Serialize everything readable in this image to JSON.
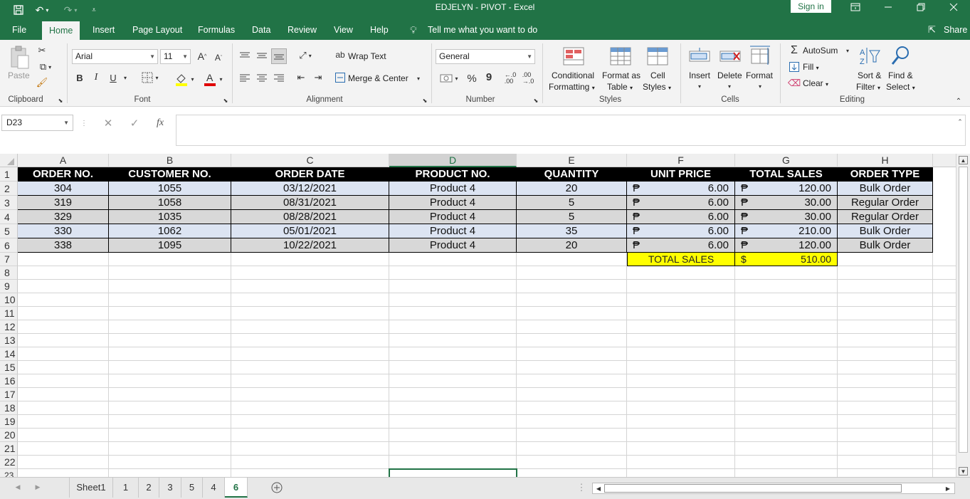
{
  "title_bar": {
    "title": "EDJELYN - PIVOT  -  Excel",
    "sign_in": "Sign in"
  },
  "menu": {
    "tabs": [
      "File",
      "Home",
      "Insert",
      "Page Layout",
      "Formulas",
      "Data",
      "Review",
      "View",
      "Help"
    ],
    "tell_me": "Tell me what you want to do",
    "share": "Share"
  },
  "ribbon": {
    "clipboard": {
      "paste": "Paste",
      "label": "Clipboard"
    },
    "font": {
      "name": "Arial",
      "size": "11",
      "bold": "B",
      "italic": "I",
      "underline": "U",
      "grow": "A",
      "shrink": "A",
      "label": "Font"
    },
    "alignment": {
      "wrap_text": "Wrap Text",
      "merge_center": "Merge & Center",
      "label": "Alignment"
    },
    "number": {
      "format": "General",
      "percent": "%",
      "comma": "9",
      "label": "Number"
    },
    "styles": {
      "conditional": [
        "Conditional",
        "Formatting"
      ],
      "format_table": [
        "Format as",
        "Table"
      ],
      "cell_styles": [
        "Cell",
        "Styles"
      ],
      "label": "Styles"
    },
    "cells": {
      "insert": "Insert",
      "delete": "Delete",
      "format": "Format",
      "label": "Cells"
    },
    "editing": {
      "autosum": "AutoSum",
      "fill": "Fill",
      "clear": "Clear",
      "sort": [
        "Sort &",
        "Filter"
      ],
      "find": [
        "Find &",
        "Select"
      ],
      "label": "Editing"
    }
  },
  "formula_bar": {
    "name_box": "D23",
    "fx": "fx",
    "value": ""
  },
  "sheet": {
    "columns": [
      "A",
      "B",
      "C",
      "D",
      "E",
      "F",
      "G",
      "H"
    ],
    "selected_column": "D",
    "row_numbers": [
      "1",
      "2",
      "3",
      "4",
      "5",
      "6",
      "7",
      "8",
      "9",
      "10",
      "11",
      "12",
      "13",
      "14",
      "15",
      "16",
      "17",
      "18",
      "19",
      "20",
      "21",
      "22",
      "23"
    ],
    "headers": [
      "ORDER NO.",
      "CUSTOMER NO.",
      "ORDER DATE",
      "PRODUCT NO.",
      "QUANTITY",
      "UNIT PRICE",
      "TOTAL SALES",
      "ORDER TYPE"
    ],
    "currency_symbol": "₱",
    "rows": [
      {
        "order_no": "304",
        "customer_no": "1055",
        "order_date": "03/12/2021",
        "product_no": "Product 4",
        "quantity": "20",
        "unit_price": "6.00",
        "total_sales": "120.00",
        "order_type": "Bulk Order"
      },
      {
        "order_no": "319",
        "customer_no": "1058",
        "order_date": "08/31/2021",
        "product_no": "Product 4",
        "quantity": "5",
        "unit_price": "6.00",
        "total_sales": "30.00",
        "order_type": "Regular Order"
      },
      {
        "order_no": "329",
        "customer_no": "1035",
        "order_date": "08/28/2021",
        "product_no": "Product 4",
        "quantity": "5",
        "unit_price": "6.00",
        "total_sales": "30.00",
        "order_type": "Regular Order"
      },
      {
        "order_no": "330",
        "customer_no": "1062",
        "order_date": "05/01/2021",
        "product_no": "Product 4",
        "quantity": "35",
        "unit_price": "6.00",
        "total_sales": "210.00",
        "order_type": "Bulk Order"
      },
      {
        "order_no": "338",
        "customer_no": "1095",
        "order_date": "10/22/2021",
        "product_no": "Product 4",
        "quantity": "20",
        "unit_price": "6.00",
        "total_sales": "120.00",
        "order_type": "Bulk Order"
      }
    ],
    "total": {
      "label": "TOTAL SALES",
      "currency": "$",
      "value": "510.00"
    },
    "active_cell": "D23"
  },
  "sheet_tabs": {
    "tabs": [
      "Sheet1",
      "1",
      "2",
      "3",
      "5",
      "4",
      "6"
    ],
    "active": "6"
  },
  "colors": {
    "excel_green": "#217346",
    "header_fill": "#000000",
    "row_blue": "#dce4f2",
    "row_grey": "#d8d8d8",
    "total_fill": "#ffff00"
  }
}
